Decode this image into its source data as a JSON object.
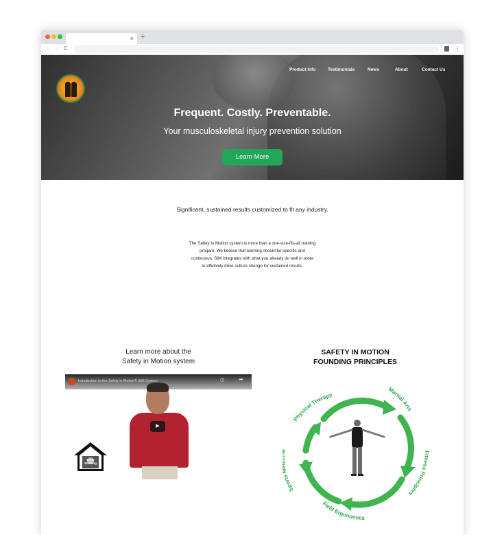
{
  "browser": {
    "tab_close": "×",
    "new_tab": "+",
    "back": "←",
    "forward": "→",
    "reload": "C",
    "menu": "⋮"
  },
  "hero": {
    "nav": [
      "Product Info",
      "Testimonials",
      "News",
      "About",
      "Contact Us"
    ],
    "title": "Frequent. Costly. Preventable.",
    "subtitle": "Your musculoskeletal injury prevention solution",
    "button": "Learn More"
  },
  "intro": {
    "tagline": "Significant, sustained results customized to fit any industry.",
    "paragraph": [
      "The Safety in Motion system is more than a one-size-fits-all training",
      "progam. We believe that learning should be specific and",
      "continuous. SIM integrates with what you already do well in order",
      "to effetively drive culture change for sustained results."
    ]
  },
  "video_section": {
    "title_lines": [
      "Learn more about the",
      "Safety in Motion system"
    ],
    "video_title": "Introduction to the Safety in Motion® SIM System",
    "play": "▶",
    "clock": "◷",
    "share": "➦",
    "house_text": [
      "Early",
      "Warning"
    ]
  },
  "principles": {
    "title_lines": [
      "SAFETY IN MOTION",
      "FOUNDING PRINCIPLES"
    ],
    "labels": [
      "Physical Therapy",
      "Martial Arts",
      "Fitness Principles",
      "Field Ergonomics",
      "Sports Medicine"
    ],
    "color": "#2ba84a"
  }
}
